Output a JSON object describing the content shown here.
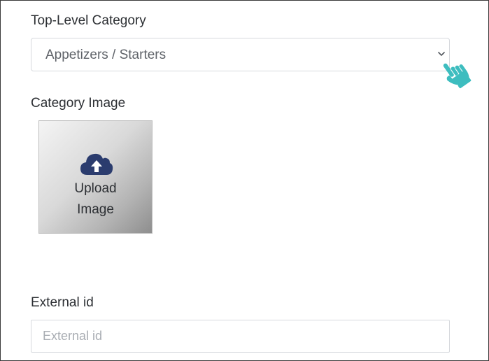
{
  "form": {
    "category": {
      "label": "Top-Level Category",
      "selected_value": "Appetizers / Starters"
    },
    "image": {
      "label": "Category Image",
      "upload_line1": "Upload",
      "upload_line2": "Image",
      "icon": "cloud-upload-icon"
    },
    "external_id": {
      "label": "External id",
      "value": "",
      "placeholder": "External id"
    }
  },
  "colors": {
    "cloud_icon": "#2b3c6e",
    "pointer_hand": "#3dbdbf"
  }
}
